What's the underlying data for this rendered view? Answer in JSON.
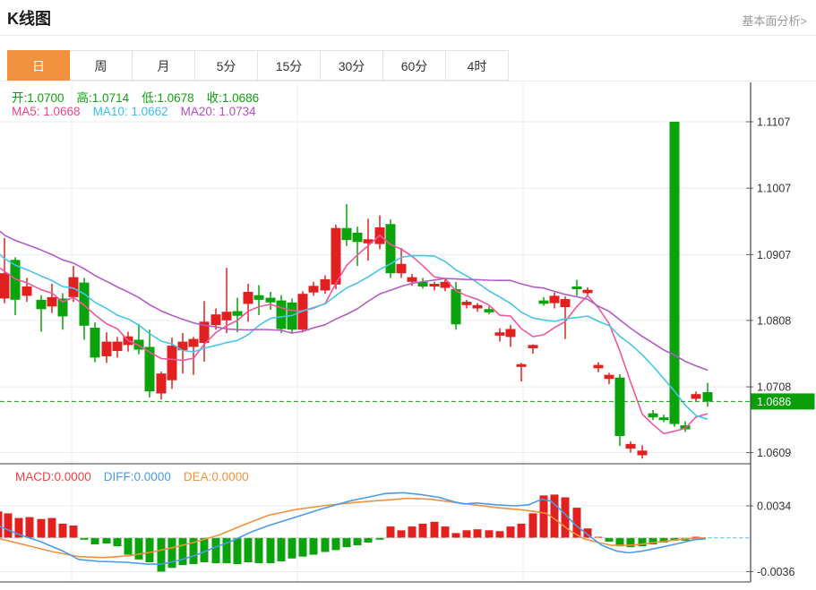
{
  "page": {
    "title": "K线图",
    "link_label": "基本面分析>"
  },
  "tabs": {
    "items": [
      "日",
      "周",
      "月",
      "5分",
      "15分",
      "30分",
      "60分",
      "4时"
    ],
    "active_index": 0
  },
  "legend": {
    "ohlc": [
      {
        "name": "ohlc-open",
        "label": "开:",
        "value": "1.0700",
        "color": "#11a011"
      },
      {
        "name": "ohlc-high",
        "label": "高:",
        "value": "1.0714",
        "color": "#11a011"
      },
      {
        "name": "ohlc-low",
        "label": "低:",
        "value": "1.0678",
        "color": "#11a011"
      },
      {
        "name": "ohlc-close",
        "label": "收:",
        "value": "1.0686",
        "color": "#11a011"
      }
    ],
    "ma": [
      {
        "name": "ma5-value",
        "label": "MA5: ",
        "value": "1.0668",
        "color": "#ef4687"
      },
      {
        "name": "ma10-value",
        "label": "MA10: ",
        "value": "1.0662",
        "color": "#3ec0e8"
      },
      {
        "name": "ma20-value",
        "label": "MA20: ",
        "value": "1.0734",
        "color": "#b44fc8"
      }
    ],
    "macd": [
      {
        "name": "macd-value",
        "label": "MACD:",
        "value": "0.0000",
        "color": "#f04141"
      },
      {
        "name": "diff-value",
        "label": "DIFF:",
        "value": "0.0000",
        "color": "#4b9be8"
      },
      {
        "name": "dea-value",
        "label": "DEA:",
        "value": "0.0000",
        "color": "#f2913d"
      }
    ]
  },
  "colors": {
    "up": "#e22020",
    "down": "#0ba30b",
    "ma5": "#f3569c",
    "ma10": "#46c6e5",
    "ma20": "#b35cc6",
    "diff": "#4b9be8",
    "dea": "#f2913d",
    "grid": "#e8edf4",
    "axis": "#444444",
    "tick_text": "#333333",
    "price_line": "#0ba30b",
    "badge_bg": "#0a9e0a",
    "badge_text": "#ffffff",
    "zero_dash": "#cccccc",
    "macd_tail": "#79d0ea",
    "tab_active_bg": "#f2913d"
  },
  "chart_data": {
    "type": "candlestick",
    "title": "K线图",
    "convention": "red = up candle, green = down candle (Chinese style)",
    "x_axis_labels": [],
    "v_gridlines": [
      80,
      332,
      584
    ],
    "y_axis": {
      "ticks": [
        1.1107,
        1.1007,
        1.0907,
        1.0808,
        1.0708,
        1.0609
      ],
      "current_price": 1.0686
    },
    "ma_periods": [
      5,
      10,
      20
    ],
    "prehistory_closes": [
      1.1,
      1.0995,
      1.099,
      1.0985,
      1.098,
      1.0975,
      1.097,
      1.0965,
      1.096,
      1.0952,
      1.0944,
      1.0936,
      1.0928,
      1.092,
      1.0912,
      1.0904,
      1.0896,
      1.0888,
      1.0878,
      1.0868
    ],
    "candles": [
      [
        5,
        1.0841,
        1.0932,
        1.0834,
        1.0879
      ],
      [
        17,
        1.0899,
        1.0903,
        1.0816,
        1.0839
      ],
      [
        30,
        1.0845,
        1.0872,
        1.0836,
        1.0859
      ],
      [
        46,
        1.0839,
        1.0846,
        1.0791,
        1.0825
      ],
      [
        58,
        1.0829,
        1.0863,
        1.0819,
        1.0843
      ],
      [
        70,
        1.0841,
        1.0849,
        1.0794,
        1.0814
      ],
      [
        82,
        1.0843,
        1.089,
        1.0836,
        1.0873
      ],
      [
        94,
        1.0865,
        1.0872,
        1.0779,
        1.08
      ],
      [
        106,
        1.0797,
        1.0805,
        1.0745,
        1.0752
      ],
      [
        119,
        1.0754,
        1.079,
        1.0744,
        1.0776
      ],
      [
        131,
        1.0762,
        1.0783,
        1.0752,
        1.0776
      ],
      [
        143,
        1.0771,
        1.0791,
        1.0761,
        1.0784
      ],
      [
        155,
        1.0779,
        1.0803,
        1.0757,
        1.0764
      ],
      [
        167,
        1.0768,
        1.0794,
        1.0692,
        1.0701
      ],
      [
        180,
        1.0698,
        1.0731,
        1.0689,
        1.0728
      ],
      [
        192,
        1.0718,
        1.0782,
        1.0705,
        1.077
      ],
      [
        204,
        1.0763,
        1.0789,
        1.0728,
        1.0776
      ],
      [
        216,
        1.0768,
        1.0783,
        1.0726,
        1.078
      ],
      [
        228,
        1.0774,
        1.0837,
        1.0746,
        1.0806
      ],
      [
        241,
        1.0801,
        1.0826,
        1.0794,
        1.0817
      ],
      [
        253,
        1.0808,
        1.0887,
        1.0789,
        1.0821
      ],
      [
        265,
        1.0822,
        1.0842,
        1.079,
        1.0815
      ],
      [
        277,
        1.0833,
        1.0863,
        1.0806,
        1.0851
      ],
      [
        289,
        1.0846,
        1.0861,
        1.0816,
        1.0839
      ],
      [
        302,
        1.0842,
        1.0851,
        1.0824,
        1.0835
      ],
      [
        314,
        1.0838,
        1.0846,
        1.0789,
        1.0795
      ],
      [
        326,
        1.0835,
        1.0841,
        1.0788,
        1.0794
      ],
      [
        338,
        1.0794,
        1.0852,
        1.079,
        1.0848
      ],
      [
        350,
        1.085,
        1.0866,
        1.0845,
        1.086
      ],
      [
        363,
        1.0853,
        1.0876,
        1.0848,
        1.087
      ],
      [
        375,
        1.0862,
        1.0952,
        1.0855,
        1.0947
      ],
      [
        387,
        1.0947,
        1.0983,
        1.092,
        1.0929
      ],
      [
        399,
        1.094,
        1.0949,
        1.089,
        1.0926
      ],
      [
        411,
        1.0924,
        1.0961,
        1.0898,
        1.093
      ],
      [
        424,
        1.0923,
        1.0966,
        1.0915,
        1.0948
      ],
      [
        436,
        1.0953,
        1.096,
        1.0872,
        1.0879
      ],
      [
        448,
        1.0879,
        1.0917,
        1.0872,
        1.0893
      ],
      [
        460,
        1.0866,
        1.0878,
        1.086,
        1.0873
      ],
      [
        472,
        1.0866,
        1.0872,
        1.0856,
        1.0859
      ],
      [
        485,
        1.0859,
        1.0866,
        1.0853,
        1.0863
      ],
      [
        497,
        1.0857,
        1.087,
        1.0852,
        1.0866
      ],
      [
        509,
        1.0855,
        1.0866,
        1.0794,
        1.0802
      ],
      [
        521,
        1.0831,
        1.0839,
        1.0826,
        1.0836
      ],
      [
        533,
        1.0826,
        1.0834,
        1.0821,
        1.0831
      ],
      [
        546,
        1.0825,
        1.0829,
        1.0817,
        1.082
      ],
      [
        558,
        1.0785,
        1.0796,
        1.0776,
        1.079
      ],
      [
        570,
        1.0783,
        1.0801,
        1.0768,
        1.0795
      ],
      [
        582,
        1.0738,
        1.0744,
        1.0716,
        1.0742
      ],
      [
        595,
        1.0766,
        1.0772,
        1.0758,
        1.0771
      ],
      [
        607,
        1.0838,
        1.0843,
        1.083,
        1.0833
      ],
      [
        619,
        1.0834,
        1.085,
        1.0826,
        1.0845
      ],
      [
        631,
        1.0828,
        1.0844,
        1.078,
        1.084
      ],
      [
        644,
        1.0859,
        1.0869,
        1.0845,
        1.0855
      ],
      [
        656,
        1.0849,
        1.0858,
        1.0845,
        1.0854
      ],
      [
        668,
        1.0736,
        1.0745,
        1.073,
        1.0741
      ],
      [
        680,
        1.072,
        1.0729,
        1.0712,
        1.0726
      ],
      [
        692,
        1.0722,
        1.0727,
        1.0619,
        1.0634
      ],
      [
        704,
        1.0615,
        1.0626,
        1.0609,
        1.0622
      ],
      [
        717,
        1.0605,
        1.062,
        1.06,
        1.0612
      ],
      [
        729,
        1.0668,
        1.0673,
        1.0658,
        1.0662
      ],
      [
        741,
        1.0662,
        1.0666,
        1.0655,
        1.0658
      ],
      [
        753,
        1.1107,
        1.1107,
        1.0648,
        1.0652
      ],
      [
        765,
        1.065,
        1.0656,
        1.064,
        1.0644
      ],
      [
        777,
        1.069,
        1.0701,
        1.0686,
        1.0697
      ],
      [
        790,
        1.07,
        1.0714,
        1.0678,
        1.0686
      ]
    ],
    "macd": {
      "ticks": [
        0.0034,
        -0.0036
      ],
      "bars": [
        [
          -2,
          0.0028
        ],
        [
          9,
          0.0026
        ],
        [
          21,
          0.0021
        ],
        [
          33,
          0.0022
        ],
        [
          46,
          0.002
        ],
        [
          58,
          0.0021
        ],
        [
          70,
          0.0015
        ],
        [
          82,
          0.0013
        ],
        [
          94,
          -0.0002
        ],
        [
          106,
          -0.0007
        ],
        [
          119,
          -0.0006
        ],
        [
          131,
          -0.0009
        ],
        [
          143,
          -0.0018
        ],
        [
          155,
          -0.0023
        ],
        [
          167,
          -0.0026
        ],
        [
          180,
          -0.0036
        ],
        [
          192,
          -0.0032
        ],
        [
          204,
          -0.0029
        ],
        [
          216,
          -0.0028
        ],
        [
          228,
          -0.0026
        ],
        [
          241,
          -0.0027
        ],
        [
          253,
          -0.0027
        ],
        [
          265,
          -0.0028
        ],
        [
          277,
          -0.0026
        ],
        [
          289,
          -0.0027
        ],
        [
          302,
          -0.0027
        ],
        [
          314,
          -0.0025
        ],
        [
          326,
          -0.0022
        ],
        [
          338,
          -0.002
        ],
        [
          350,
          -0.0018
        ],
        [
          363,
          -0.0015
        ],
        [
          375,
          -0.0013
        ],
        [
          387,
          -0.001
        ],
        [
          399,
          -0.0008
        ],
        [
          411,
          -0.0005
        ],
        [
          424,
          -0.0002
        ],
        [
          436,
          0.0012
        ],
        [
          448,
          0.0008
        ],
        [
          460,
          0.0012
        ],
        [
          472,
          0.0015
        ],
        [
          485,
          0.0017
        ],
        [
          497,
          0.0012
        ],
        [
          509,
          0.0005
        ],
        [
          521,
          0.0008
        ],
        [
          533,
          0.0009
        ],
        [
          546,
          0.0008
        ],
        [
          558,
          0.0007
        ],
        [
          570,
          0.0012
        ],
        [
          582,
          0.0015
        ],
        [
          595,
          0.0026
        ],
        [
          607,
          0.0045
        ],
        [
          619,
          0.0046
        ],
        [
          631,
          0.0043
        ],
        [
          644,
          0.0032
        ],
        [
          656,
          0.001
        ],
        [
          668,
          0.0001
        ],
        [
          680,
          -0.0004
        ],
        [
          692,
          -0.0009
        ],
        [
          704,
          -0.001
        ],
        [
          717,
          -0.0009
        ],
        [
          729,
          -0.0007
        ],
        [
          741,
          -0.0005
        ],
        [
          753,
          -0.0003
        ],
        [
          765,
          -0.0003
        ],
        [
          777,
          0.0001
        ],
        [
          790,
          0.0
        ]
      ],
      "diff": [
        [
          0,
          0.0012
        ],
        [
          20,
          0.0004
        ],
        [
          45,
          -0.0004
        ],
        [
          70,
          -0.0014
        ],
        [
          88,
          -0.0023
        ],
        [
          110,
          -0.0025
        ],
        [
          140,
          -0.0026
        ],
        [
          165,
          -0.0028
        ],
        [
          180,
          -0.0028
        ],
        [
          200,
          -0.0024
        ],
        [
          220,
          -0.0018
        ],
        [
          240,
          -0.001
        ],
        [
          260,
          -0.0003
        ],
        [
          280,
          0.0006
        ],
        [
          300,
          0.0013
        ],
        [
          330,
          0.0022
        ],
        [
          360,
          0.0031
        ],
        [
          390,
          0.0039
        ],
        [
          415,
          0.0044
        ],
        [
          430,
          0.0047
        ],
        [
          450,
          0.0048
        ],
        [
          470,
          0.0046
        ],
        [
          490,
          0.0043
        ],
        [
          508,
          0.0038
        ],
        [
          518,
          0.0036
        ],
        [
          532,
          0.0037
        ],
        [
          555,
          0.0035
        ],
        [
          575,
          0.0034
        ],
        [
          590,
          0.0035
        ],
        [
          605,
          0.0041
        ],
        [
          615,
          0.0039
        ],
        [
          628,
          0.0028
        ],
        [
          642,
          0.0014
        ],
        [
          658,
          0.0002
        ],
        [
          672,
          -0.0008
        ],
        [
          688,
          -0.0014
        ],
        [
          702,
          -0.0016
        ],
        [
          718,
          -0.0014
        ],
        [
          733,
          -0.0011
        ],
        [
          748,
          -0.0008
        ],
        [
          762,
          -0.0005
        ],
        [
          775,
          -0.0002
        ],
        [
          788,
          -0.0001
        ]
      ],
      "dea": [
        [
          0,
          -0.0001
        ],
        [
          30,
          -0.0008
        ],
        [
          60,
          -0.0015
        ],
        [
          88,
          -0.002
        ],
        [
          115,
          -0.0021
        ],
        [
          145,
          -0.0019
        ],
        [
          170,
          -0.0015
        ],
        [
          195,
          -0.001
        ],
        [
          220,
          -0.0004
        ],
        [
          245,
          0.0003
        ],
        [
          270,
          0.0013
        ],
        [
          300,
          0.0024
        ],
        [
          330,
          0.003
        ],
        [
          360,
          0.0034
        ],
        [
          390,
          0.0037
        ],
        [
          415,
          0.0039
        ],
        [
          430,
          0.004
        ],
        [
          455,
          0.0042
        ],
        [
          480,
          0.0041
        ],
        [
          505,
          0.0038
        ],
        [
          530,
          0.0035
        ],
        [
          555,
          0.0032
        ],
        [
          580,
          0.003
        ],
        [
          597,
          0.0028
        ],
        [
          610,
          0.0026
        ],
        [
          622,
          0.0018
        ],
        [
          637,
          0.0007
        ],
        [
          652,
          -0.0001
        ],
        [
          668,
          -0.0005
        ],
        [
          683,
          -0.0008
        ],
        [
          700,
          -0.0008
        ],
        [
          715,
          -0.0007
        ],
        [
          730,
          -0.0005
        ],
        [
          748,
          -0.0003
        ],
        [
          765,
          -0.0001
        ],
        [
          788,
          0.0
        ]
      ]
    }
  }
}
